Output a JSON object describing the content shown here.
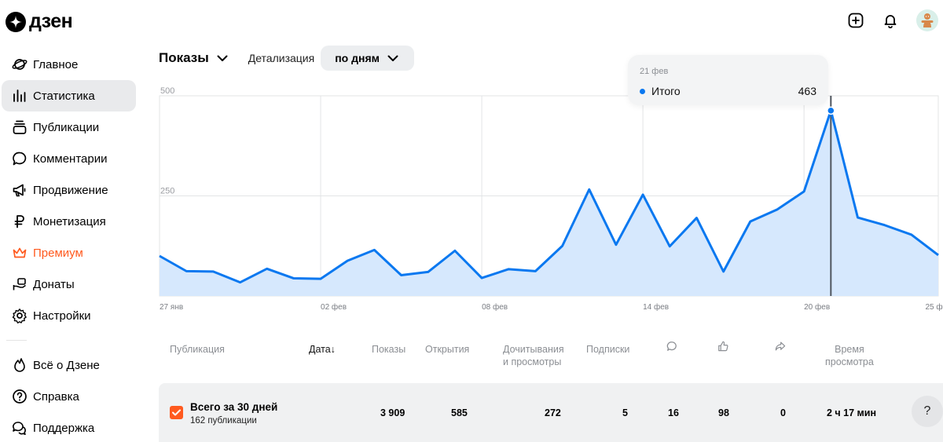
{
  "brand": {
    "name": "дзен"
  },
  "header": {
    "icons": [
      "plus-square-icon",
      "bell-icon",
      "avatar"
    ]
  },
  "sidebar": {
    "items": [
      {
        "label": "Главное",
        "icon": "planet-icon"
      },
      {
        "label": "Статистика",
        "icon": "bar-chart-icon",
        "active": true
      },
      {
        "label": "Публикации",
        "icon": "stack-icon"
      },
      {
        "label": "Комментарии",
        "icon": "comment-icon"
      },
      {
        "label": "Продвижение",
        "icon": "megaphone-icon"
      },
      {
        "label": "Монетизация",
        "icon": "ruble-icon"
      },
      {
        "label": "Премиум",
        "icon": "crown-icon",
        "accent": "#ff5a1f"
      },
      {
        "label": "Донаты",
        "icon": "donate-hand-icon"
      },
      {
        "label": "Настройки",
        "icon": "gear-icon"
      }
    ],
    "secondary": [
      {
        "label": "Всё о Дзене",
        "icon": "flame-icon"
      },
      {
        "label": "Справка",
        "icon": "question-circle-icon"
      },
      {
        "label": "Поддержка",
        "icon": "chat-bubbles-icon"
      }
    ]
  },
  "controls": {
    "metric": "Показы",
    "detail_label": "Детализация",
    "detail_value": "по дням"
  },
  "tooltip": {
    "date": "21 фев",
    "series": "Итого",
    "value": "463"
  },
  "chart_data": {
    "type": "area",
    "x": [
      "27 янв",
      "28 янв",
      "29 янв",
      "30 янв",
      "31 янв",
      "01 фев",
      "02 фев",
      "03 фев",
      "04 фев",
      "05 фев",
      "06 фев",
      "07 фев",
      "08 фев",
      "09 фев",
      "10 фев",
      "11 фев",
      "12 фев",
      "13 фев",
      "14 фев",
      "15 фев",
      "16 фев",
      "17 фев",
      "18 фев",
      "19 фев",
      "20 фев",
      "21 фев",
      "22 фев",
      "23 фев",
      "24 фев",
      "25 фев"
    ],
    "series": [
      {
        "name": "Итого",
        "values": [
          100,
          62,
          61,
          34,
          68,
          44,
          43,
          88,
          115,
          52,
          60,
          113,
          45,
          67,
          62,
          125,
          266,
          128,
          253,
          124,
          195,
          61,
          186,
          216,
          261,
          463,
          196,
          177,
          153,
          102
        ]
      }
    ],
    "x_tick_labels": [
      "27 янв",
      "02 фев",
      "08 фев",
      "14 фев",
      "20 фев",
      "25 фев"
    ],
    "y_ticks": [
      0,
      250,
      500
    ],
    "ylim": [
      0,
      500
    ],
    "grid": true,
    "highlight_index": 25,
    "colors": {
      "line": "#0a78f0",
      "fill": "#d6e8fd",
      "marker_line": "#50565f"
    }
  },
  "table": {
    "headers": [
      "Публикация",
      "Дата↓",
      "Показы",
      "Открытия",
      "Дочитывания\nи просмотры",
      "Подписки",
      "",
      "",
      "",
      "Время\nпросмотра"
    ],
    "header_icons": [
      "comment-icon",
      "thumbs-up-icon",
      "share-icon"
    ],
    "summary": {
      "title": "Всего за 30 дней",
      "subtitle": "162 публикации",
      "impressions": "3 909",
      "opens": "585",
      "reads": "272",
      "subscriptions": "5",
      "comments": "16",
      "likes": "98",
      "shares": "0",
      "watch_time": "2 ч 17 мин"
    }
  },
  "help": {
    "label": "?"
  }
}
